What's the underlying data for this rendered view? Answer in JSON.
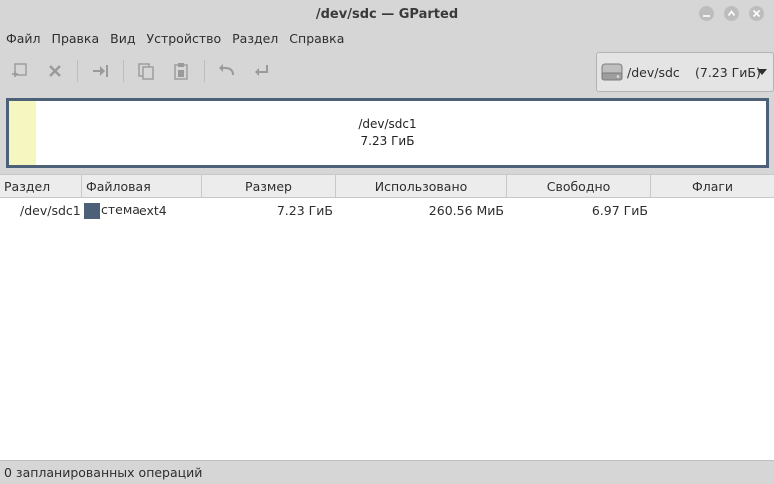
{
  "window": {
    "title": "/dev/sdc — GParted"
  },
  "menu": [
    "Файл",
    "Правка",
    "Вид",
    "Устройство",
    "Раздел",
    "Справка"
  ],
  "toolbar": {
    "icons": [
      "new-partition-icon",
      "delete-icon",
      "resize-move-icon",
      "copy-icon",
      "paste-icon",
      "undo-icon",
      "apply-icon"
    ]
  },
  "device": {
    "name": "/dev/sdc",
    "size": "(7.23 ГиБ)"
  },
  "graph": {
    "partition_name": "/dev/sdc1",
    "partition_size": "7.23 ГиБ",
    "used_fraction": 0.036
  },
  "table": {
    "columns": [
      "Раздел",
      "Файловая система",
      "Размер",
      "Использовано",
      "Свободно",
      "Флаги"
    ],
    "rows": [
      {
        "partition": "/dev/sdc1",
        "filesystem": "ext4",
        "fs_color": "#4c6177",
        "size": "7.23 ГиБ",
        "used": "260.56 МиБ",
        "free": "6.97 ГиБ",
        "flags": ""
      }
    ]
  },
  "status": {
    "text": "0 запланированных операций"
  }
}
